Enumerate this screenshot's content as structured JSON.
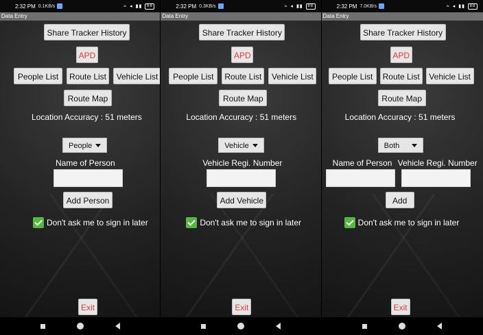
{
  "phones": [
    {
      "status_time": "2:32 PM",
      "status_rate": "0.1KB/s",
      "status_battery": "88",
      "app_title": "Data Entry",
      "share_label": "Share Tracker History",
      "apd_label": "APD",
      "people_label": "People List",
      "route_list_label": "Route List",
      "vehicle_list_label": "Vehicle List",
      "route_map_label": "Route Map",
      "location_accuracy": "Location Accuracy :  51 meters",
      "dropdown_value": "People",
      "field_label": "Name of Person",
      "add_label": "Add Person",
      "checkbox_label": "Don't ask me to sign in later",
      "exit_label": "Exit"
    },
    {
      "status_time": "2:32 PM",
      "status_rate": "0.3KB/s",
      "status_battery": "88",
      "app_title": "Data Entry",
      "share_label": "Share Tracker History",
      "apd_label": "APD",
      "people_label": "People List",
      "route_list_label": "Route List",
      "vehicle_list_label": "Vehicle List",
      "route_map_label": "Route Map",
      "location_accuracy": "Location Accuracy :  51 meters",
      "dropdown_value": "Vehicle",
      "field_label": "Vehicle Regi. Number",
      "add_label": "Add Vehicle",
      "checkbox_label": "Don't ask me to sign in later",
      "exit_label": "Exit"
    },
    {
      "status_time": "2:32 PM",
      "status_rate": "7.0KB/s",
      "status_battery": "88",
      "app_title": "Data Entry",
      "share_label": "Share Tracker History",
      "apd_label": "APD",
      "people_label": "People List",
      "route_list_label": "Route List",
      "vehicle_list_label": "Vehicle List",
      "route_map_label": "Route Map",
      "location_accuracy": "Location Accuracy :  51 meters",
      "dropdown_value": "Both",
      "field_label_1": "Name of Person",
      "field_label_2": "Vehicle Regi. Number",
      "add_label": "Add",
      "checkbox_label": "Don't ask me to sign in later",
      "exit_label": "Exit"
    }
  ],
  "colors": {
    "accent_red": "#e03b3b",
    "check_green": "#55b93e",
    "appbar": "#6f6f6f"
  }
}
